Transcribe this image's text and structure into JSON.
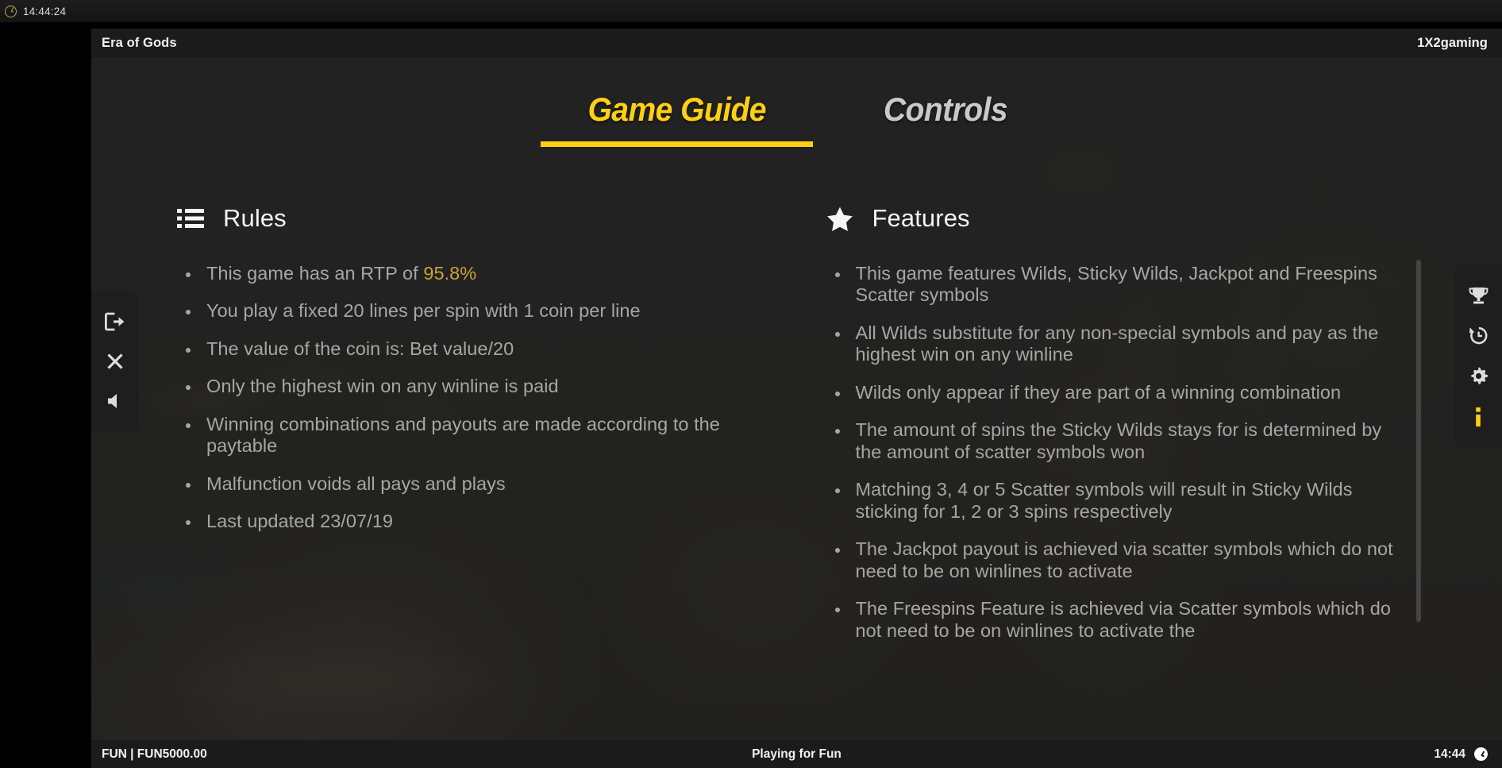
{
  "os_taskbar": {
    "clock_icon": "clock-outline-icon",
    "time": "14:44:24"
  },
  "window": {
    "title": "Era of Gods",
    "provider": "1X2gaming"
  },
  "tabs": [
    {
      "label": "Game Guide",
      "active": true
    },
    {
      "label": "Controls",
      "active": false
    }
  ],
  "rules": {
    "icon": "list-icon",
    "heading": "Rules",
    "items": [
      {
        "text": "This game has an RTP of ",
        "highlight": "95.8%"
      },
      {
        "text": "You play a fixed 20 lines per spin with 1 coin per line"
      },
      {
        "text": "The value of the coin is: Bet value/20"
      },
      {
        "text": "Only the highest win on any winline is paid"
      },
      {
        "text": "Winning combinations and payouts are made according to the paytable"
      },
      {
        "text": "Malfunction voids all pays and plays"
      },
      {
        "text": "Last updated 23/07/19"
      }
    ]
  },
  "features": {
    "icon": "star-icon",
    "heading": "Features",
    "items": [
      {
        "text": "This game features Wilds, Sticky Wilds, Jackpot and Freespins Scatter symbols"
      },
      {
        "text": "All Wilds substitute for any non-special symbols and pay as the highest win on any winline"
      },
      {
        "text": "Wilds only appear if they are part of a winning combination"
      },
      {
        "text": "The amount of spins the Sticky Wilds stays for is determined by the amount of scatter symbols won"
      },
      {
        "text": "Matching 3, 4 or 5 Scatter symbols will result in Sticky Wilds sticking for 1, 2 or 3 spins respectively"
      },
      {
        "text": "The Jackpot payout is achieved via scatter symbols which do not need to be on winlines to activate"
      },
      {
        "text": "The Freespins Feature is achieved via Scatter symbols which do not need to be on winlines to activate the"
      }
    ]
  },
  "dock_left": [
    {
      "icon": "exit-icon",
      "name": "exit-button"
    },
    {
      "icon": "close-icon",
      "name": "close-button"
    },
    {
      "icon": "sound-muted-icon",
      "name": "sound-button"
    }
  ],
  "dock_right": [
    {
      "icon": "trophy-icon",
      "name": "jackpot-button",
      "active": false
    },
    {
      "icon": "history-icon",
      "name": "history-button",
      "active": false
    },
    {
      "icon": "gear-icon",
      "name": "settings-button",
      "active": false
    },
    {
      "icon": "info-icon",
      "name": "info-button",
      "active": true
    }
  ],
  "bottom_bar": {
    "balance": "FUN | FUN5000.00",
    "mode": "Playing for Fun",
    "time": "14:44",
    "clock_icon": "clock-filled-icon"
  },
  "colors": {
    "accent": "#ffcf14",
    "highlight": "#c9a33a",
    "text_body": "#a6a6a6",
    "text_head": "#f4f4f4",
    "chrome": "#1b1b1b",
    "stage": "#242424"
  }
}
